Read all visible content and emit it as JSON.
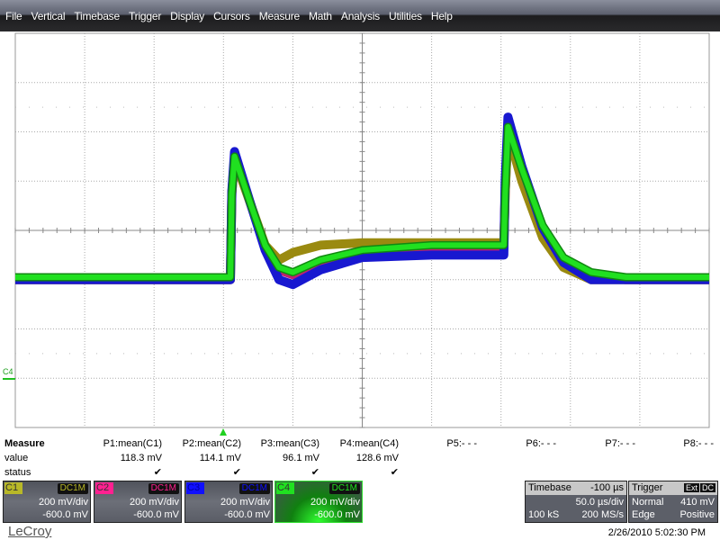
{
  "menu": [
    "File",
    "Vertical",
    "Timebase",
    "Trigger",
    "Display",
    "Cursors",
    "Measure",
    "Math",
    "Analysis",
    "Utilities",
    "Help"
  ],
  "measure": {
    "title": "Measure",
    "value_label": "value",
    "status_label": "status",
    "params": [
      {
        "name": "P1:mean(C1)",
        "value": "118.3 mV",
        "status": "✔"
      },
      {
        "name": "P2:mean(C2)",
        "value": "114.1 mV",
        "status": "✔"
      },
      {
        "name": "P3:mean(C3)",
        "value": "96.1 mV",
        "status": "✔"
      },
      {
        "name": "P4:mean(C4)",
        "value": "128.6 mV",
        "status": "✔"
      },
      {
        "name": "P5:- - -"
      },
      {
        "name": "P6:- - -"
      },
      {
        "name": "P7:- - -"
      },
      {
        "name": "P8:- - -"
      }
    ]
  },
  "channels": [
    {
      "id": "C1",
      "coupling": "DC1M",
      "vdiv": "200 mV/div",
      "offset": "-600.0 mV",
      "color": "#b8b828",
      "selected": false
    },
    {
      "id": "C2",
      "coupling": "DC1M",
      "vdiv": "200 mV/div",
      "offset": "-600.0 mV",
      "color": "#ff2090",
      "selected": false
    },
    {
      "id": "C3",
      "coupling": "DC1M",
      "vdiv": "200 mV/div",
      "offset": "-600.0 mV",
      "color": "#1010ff",
      "selected": false
    },
    {
      "id": "C4",
      "coupling": "DC1M",
      "vdiv": "200 mV/div",
      "offset": "-600.0 mV",
      "color": "#20e020",
      "selected": true
    }
  ],
  "timebase": {
    "label": "Timebase",
    "delay": "-100 µs",
    "tdiv": "50.0 µs/div",
    "samples": "100 kS",
    "rate": "200 MS/s"
  },
  "trigger": {
    "label": "Trigger",
    "source": "Ext",
    "coupling": "DC",
    "mode": "Normal",
    "level": "410 mV",
    "type": "Edge",
    "slope": "Positive"
  },
  "brand": "LeCroy",
  "datetime": "2/26/2010 5:02:30 PM",
  "ground_marker": "C4",
  "chart_data": {
    "type": "line",
    "x_unit": "µs",
    "y_unit": "V",
    "xlim": [
      -150,
      350
    ],
    "ylim": [
      -0.6,
      1.0
    ],
    "x_divisions": 10,
    "y_divisions": 8,
    "grid": true,
    "series": [
      {
        "name": "C2",
        "color": "#c02070",
        "points": [
          [
            -150,
            0.0
          ],
          [
            5,
            0.0
          ],
          [
            6,
            0.35
          ],
          [
            8,
            0.5
          ],
          [
            20,
            0.3
          ],
          [
            30,
            0.13
          ],
          [
            40,
            0.04
          ],
          [
            50,
            0.02
          ],
          [
            70,
            0.07
          ],
          [
            100,
            0.12
          ],
          [
            150,
            0.13
          ],
          [
            202,
            0.13
          ],
          [
            203,
            0.35
          ],
          [
            205,
            0.62
          ],
          [
            215,
            0.45
          ],
          [
            230,
            0.2
          ],
          [
            245,
            0.08
          ],
          [
            265,
            0.02
          ],
          [
            290,
            0.0
          ],
          [
            350,
            0.0
          ]
        ]
      },
      {
        "name": "C1",
        "color": "#9a8a10",
        "points": [
          [
            -150,
            0.0
          ],
          [
            5,
            0.0
          ],
          [
            6,
            0.35
          ],
          [
            8,
            0.49
          ],
          [
            20,
            0.3
          ],
          [
            30,
            0.14
          ],
          [
            40,
            0.08
          ],
          [
            50,
            0.11
          ],
          [
            70,
            0.14
          ],
          [
            100,
            0.15
          ],
          [
            150,
            0.15
          ],
          [
            202,
            0.15
          ],
          [
            203,
            0.35
          ],
          [
            205,
            0.6
          ],
          [
            215,
            0.4
          ],
          [
            230,
            0.17
          ],
          [
            245,
            0.05
          ],
          [
            265,
            0.0
          ],
          [
            290,
            0.0
          ],
          [
            350,
            0.0
          ]
        ]
      },
      {
        "name": "C3",
        "color": "#1818d0",
        "points": [
          [
            -150,
            0.0
          ],
          [
            5,
            0.0
          ],
          [
            6,
            0.36
          ],
          [
            8,
            0.52
          ],
          [
            20,
            0.3
          ],
          [
            30,
            0.12
          ],
          [
            40,
            0.0
          ],
          [
            50,
            -0.02
          ],
          [
            70,
            0.04
          ],
          [
            100,
            0.09
          ],
          [
            150,
            0.1
          ],
          [
            202,
            0.1
          ],
          [
            203,
            0.4
          ],
          [
            205,
            0.66
          ],
          [
            215,
            0.46
          ],
          [
            230,
            0.21
          ],
          [
            245,
            0.07
          ],
          [
            265,
            0.0
          ],
          [
            290,
            0.0
          ],
          [
            350,
            0.0
          ]
        ]
      },
      {
        "name": "C4",
        "color": "#20e020",
        "points": [
          [
            -150,
            0.01
          ],
          [
            5,
            0.01
          ],
          [
            6,
            0.35
          ],
          [
            8,
            0.5
          ],
          [
            20,
            0.3
          ],
          [
            30,
            0.14
          ],
          [
            40,
            0.05
          ],
          [
            50,
            0.03
          ],
          [
            70,
            0.08
          ],
          [
            100,
            0.12
          ],
          [
            150,
            0.14
          ],
          [
            202,
            0.14
          ],
          [
            203,
            0.35
          ],
          [
            205,
            0.62
          ],
          [
            215,
            0.45
          ],
          [
            230,
            0.22
          ],
          [
            245,
            0.09
          ],
          [
            265,
            0.03
          ],
          [
            290,
            0.01
          ],
          [
            350,
            0.01
          ]
        ]
      }
    ]
  }
}
